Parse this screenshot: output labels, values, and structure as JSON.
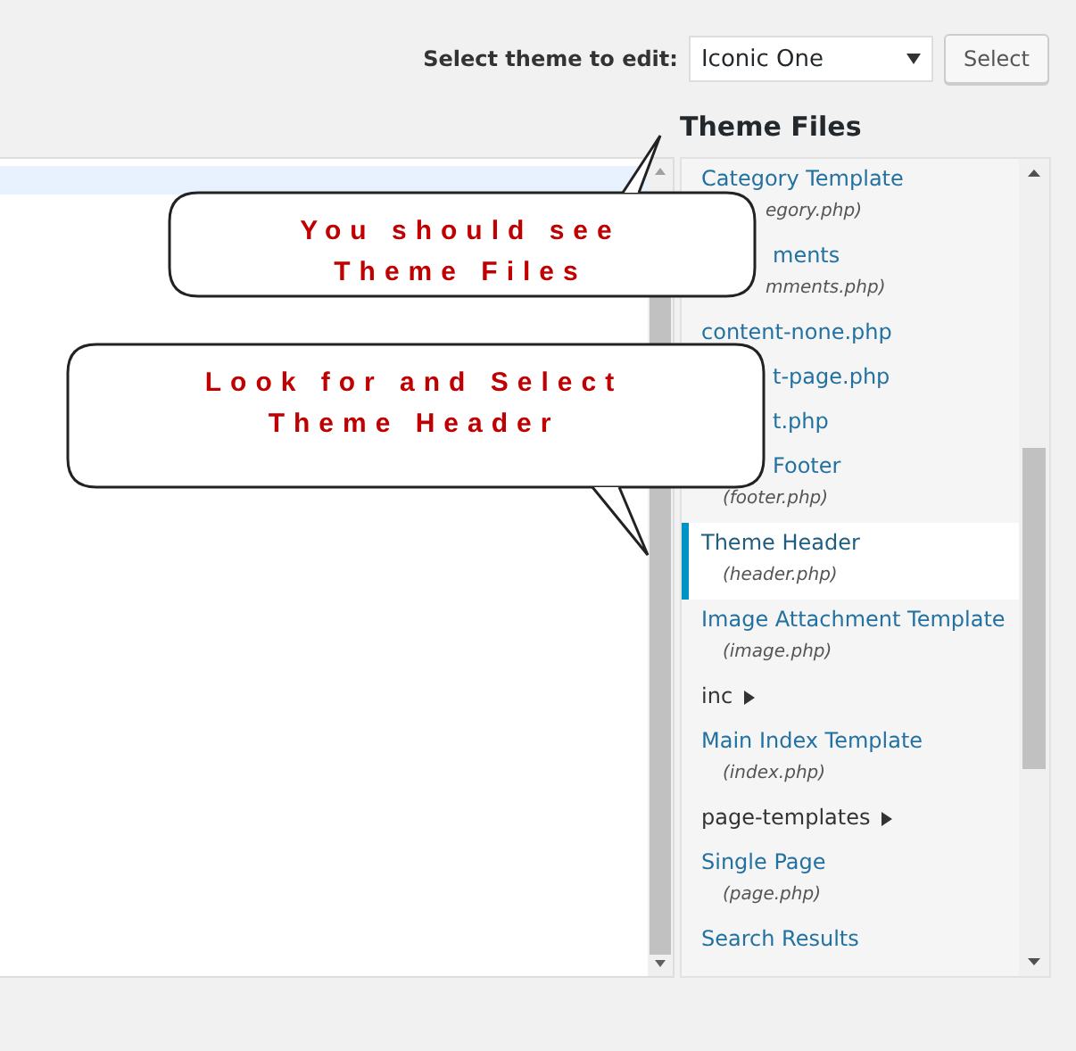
{
  "theme_picker": {
    "label": "Select theme to edit:",
    "value": "Iconic One",
    "button": "Select"
  },
  "files_heading": "Theme Files",
  "files": [
    {
      "kind": "file",
      "name": "Category Template",
      "file": "egory.php)",
      "covered_name": false,
      "covered_file": true,
      "selected": false
    },
    {
      "kind": "file",
      "name": "ments",
      "file": "mments.php)",
      "covered_name": true,
      "covered_file": true,
      "selected": false
    },
    {
      "kind": "file",
      "name": "content-none.php",
      "covered_name": false,
      "selected": false
    },
    {
      "kind": "file",
      "name": "t-page.php",
      "covered_name": true,
      "selected": false
    },
    {
      "kind": "file",
      "name": "t.php",
      "covered_name": true,
      "selected": false
    },
    {
      "kind": "file",
      "name": "Footer",
      "file": "(footer.php)",
      "covered_name": true,
      "covered_file": false,
      "selected": false
    },
    {
      "kind": "file",
      "name": "Theme Header",
      "file": "(header.php)",
      "covered_name": false,
      "covered_file": false,
      "selected": true
    },
    {
      "kind": "file",
      "name": "Image Attachment Template",
      "file": "(image.php)",
      "covered_name": false,
      "covered_file": false,
      "selected": false
    },
    {
      "kind": "folder",
      "name": "inc",
      "selected": false
    },
    {
      "kind": "file",
      "name": "Main Index Template",
      "file": "(index.php)",
      "covered_name": false,
      "covered_file": false,
      "selected": false
    },
    {
      "kind": "folder",
      "name": "page-templates",
      "selected": false
    },
    {
      "kind": "file",
      "name": "Single Page",
      "file": "(page.php)",
      "covered_name": false,
      "covered_file": false,
      "selected": false
    },
    {
      "kind": "file",
      "name": "Search Results",
      "covered_name": false,
      "selected": false
    }
  ],
  "callouts": [
    {
      "lines": [
        "You should see",
        "Theme Files"
      ]
    },
    {
      "lines": [
        "Look for and Select",
        "Theme Header"
      ]
    }
  ]
}
